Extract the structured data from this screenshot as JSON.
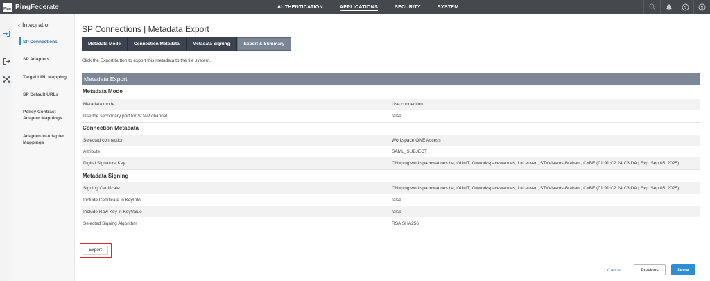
{
  "app": {
    "logo_text": "Ping",
    "brand_bold": "Ping",
    "brand_light": "Federate"
  },
  "topnav": {
    "items": [
      {
        "label": "AUTHENTICATION"
      },
      {
        "label": "APPLICATIONS",
        "active": true
      },
      {
        "label": "SECURITY"
      },
      {
        "label": "SYSTEM"
      }
    ],
    "icons": [
      "search-icon",
      "bell-icon",
      "help-icon",
      "user-icon"
    ]
  },
  "leftrail": {
    "icons": [
      "sign-in-icon",
      "sign-out-icon",
      "network-icon"
    ]
  },
  "sidebar": {
    "back_label": "Integration",
    "items": [
      {
        "label": "SP Connections",
        "active": true
      },
      {
        "label": "SP Adapters"
      },
      {
        "label": "Target URL Mapping"
      },
      {
        "label": "SP Default URLs"
      },
      {
        "label": "Policy Contract Adapter Mappings"
      },
      {
        "label": "Adapter-to-Adapter Mappings"
      }
    ]
  },
  "page": {
    "title": "SP Connections | Metadata Export",
    "tabs": [
      {
        "label": "Metadata Mode"
      },
      {
        "label": "Connection Metadata"
      },
      {
        "label": "Metadata Signing"
      },
      {
        "label": "Export & Summary",
        "active": true
      }
    ],
    "instruction": "Click the Export button to export this metadata to the file system.",
    "section_header": "Metadata Export",
    "groups": [
      {
        "title": "Metadata Mode",
        "rows": [
          {
            "label": "Metadata mode",
            "value": "Use connection"
          },
          {
            "label": "Use the secondary port for SOAP channel",
            "value": "false"
          }
        ]
      },
      {
        "title": "Connection Metadata",
        "rows": [
          {
            "label": "Selected connection",
            "value": "Workspace ONE Access"
          },
          {
            "label": "Attribute",
            "value": "SAML_SUBJECT"
          },
          {
            "label": "Digital Signature Key",
            "value": "CN=ping.workspacewannes.be, OU=IT, O=workspacewannes, L=Leuven, ST=Vlaams-Brabant, C=BE (01:91:C2:24:C3:DA | Exp: Sep 05, 2025)"
          }
        ]
      },
      {
        "title": "Metadata Signing",
        "rows": [
          {
            "label": "Signing Certificate",
            "value": "CN=ping.workspacewannes.be, OU=IT, O=workspacewannes, L=Leuven, ST=Vlaams-Brabant, C=BE (01:91:C2:24:C3:DA | Exp: Sep 05, 2025)"
          },
          {
            "label": "Include Certificate in KeyInfo",
            "value": "false"
          },
          {
            "label": "Include Raw Key in KeyValue",
            "value": "false"
          },
          {
            "label": "Selected Signing Algorithm",
            "value": "RSA SHA256"
          }
        ]
      }
    ],
    "export_label": "Export",
    "cancel_label": "Cancel",
    "previous_label": "Previous",
    "done_label": "Done"
  },
  "colors": {
    "topbar": "#45484d",
    "tab_dark": "#3d4450",
    "tab_active": "#7a8595",
    "section_header": "#7d8796",
    "primary": "#2e8ed5",
    "highlight_border": "#e0262e"
  }
}
